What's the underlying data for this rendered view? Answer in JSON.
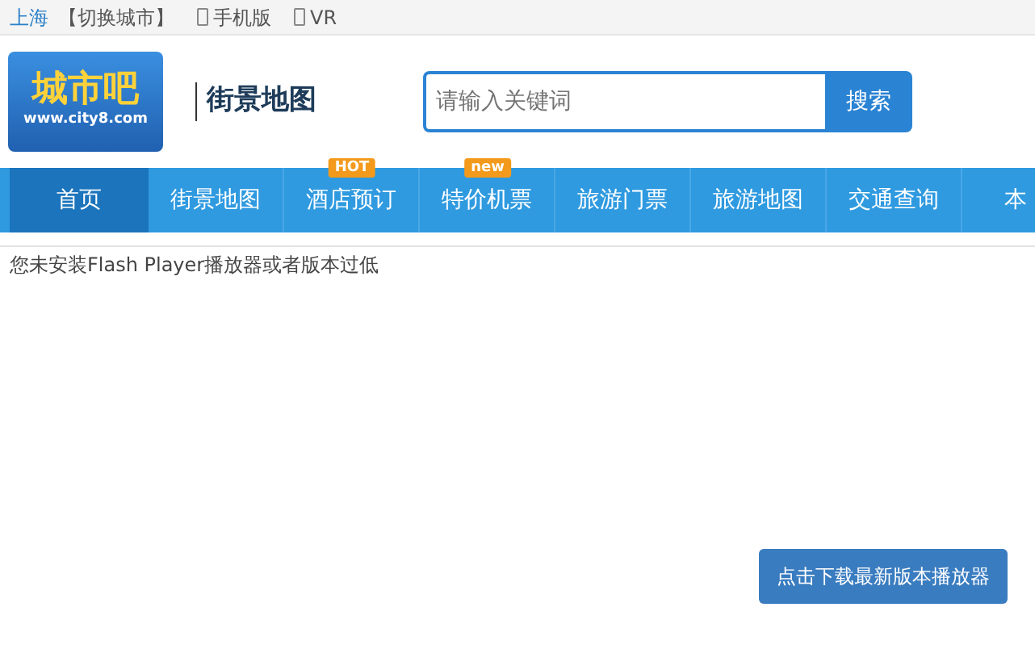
{
  "top_bar": {
    "city": "上海",
    "switch_city": "【切换城市】",
    "links": [
      {
        "label": "手机版"
      },
      {
        "label": "VR"
      }
    ]
  },
  "header": {
    "logo_text": "城市吧",
    "logo_url": "www.city8.com",
    "section": "街景地图"
  },
  "search": {
    "placeholder": "请输入关键词",
    "button": "搜索"
  },
  "nav": [
    {
      "label": "首页",
      "selected": true
    },
    {
      "label": "街景地图",
      "selected": false
    },
    {
      "label": "酒店预订",
      "selected": false,
      "badge": "HOT"
    },
    {
      "label": "特价机票",
      "selected": false,
      "badge": "new"
    },
    {
      "label": "旅游门票",
      "selected": false
    },
    {
      "label": "旅游地图",
      "selected": false
    },
    {
      "label": "交通查询",
      "selected": false
    },
    {
      "label": "本",
      "selected": false
    }
  ],
  "content": {
    "message": "您未安装Flash Player播放器或者版本过低",
    "download_button": "点击下载最新版本播放器"
  }
}
